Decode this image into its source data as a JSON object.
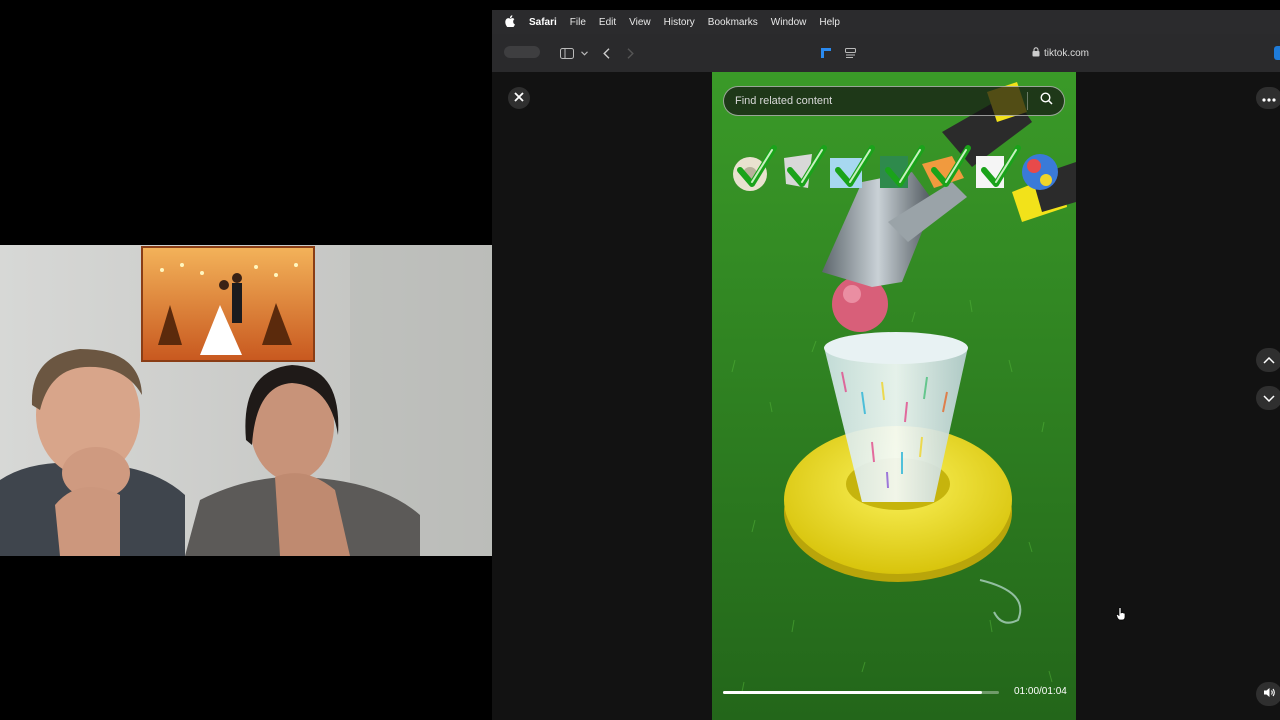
{
  "menubar": {
    "app_name": "Safari",
    "items": [
      "File",
      "Edit",
      "View",
      "History",
      "Bookmarks",
      "Window",
      "Help"
    ]
  },
  "toolbar": {
    "address": "tiktok.com"
  },
  "viewer": {
    "search": {
      "placeholder": "Find related content",
      "value": ""
    },
    "time_display": "01:00/01:04",
    "progress": 0.938
  },
  "icons": {
    "apple": "apple-icon",
    "close": "close-icon",
    "more": "more-horizontal-icon",
    "up": "chevron-up-icon",
    "down": "chevron-down-icon",
    "volume": "volume-icon",
    "search": "search-icon",
    "lock": "lock-icon"
  },
  "colors": {
    "accent": "#1e7bd9",
    "grass": "#2e7d1f",
    "ring": "#f2e21a"
  }
}
